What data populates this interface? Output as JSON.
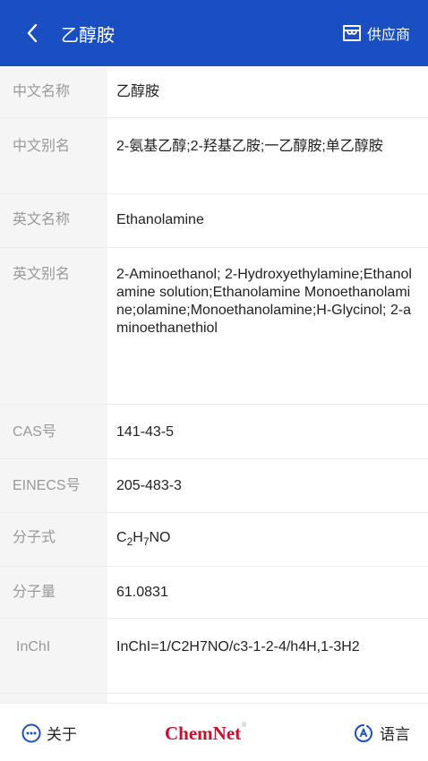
{
  "header": {
    "title": "乙醇胺",
    "supplier_label": "供应商",
    "back_icon": "chevron-left-icon",
    "supplier_icon": "storefront-icon",
    "background": "#1a4fc4"
  },
  "rows": [
    {
      "label": "中文名称",
      "value": "乙醇胺"
    },
    {
      "label": "中文别名",
      "value": "2-氨基乙醇;2-羟基乙胺;一乙醇胺;单乙醇胺"
    },
    {
      "label": "英文名称",
      "value": "Ethanolamine"
    },
    {
      "label": "英文别名",
      "value": "2-Aminoethanol; 2-Hydroxyethylamine;Ethanolamine solution;Ethanolamine Monoethanolamine;olamine;Monoethanolamine;H-Glycinol; 2-aminoethanethiol"
    },
    {
      "label": "CAS号",
      "value": "141-43-5"
    },
    {
      "label": "EINECS号",
      "value": "205-483-3"
    },
    {
      "label": "分子式",
      "formula": {
        "c": "C",
        "c_sub": "2",
        "h": "H",
        "h_sub": "7",
        "rest": "NO"
      }
    },
    {
      "label": "分子量",
      "value": "61.0831"
    },
    {
      "label": "InChI",
      "value": "InChI=1/C2H7NO/c3-1-2-4/h4H,1-3H2"
    }
  ],
  "footer": {
    "about_label": "关于",
    "about_icon": "more-circle-icon",
    "brand": "ChemNet",
    "brand_mark": "®",
    "language_label": "语言",
    "language_icon": "language-icon",
    "brand_color": "#c8102e"
  }
}
